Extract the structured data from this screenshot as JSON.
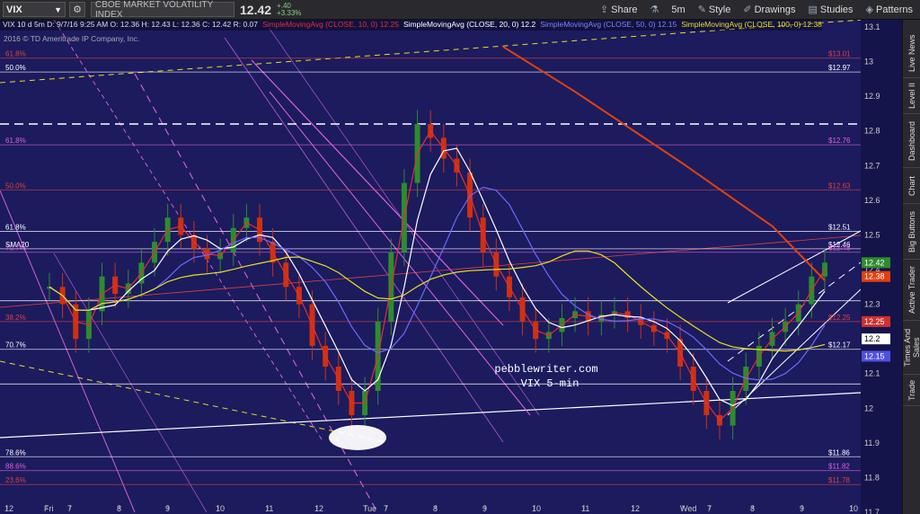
{
  "toolbar": {
    "symbol": "VIX",
    "symbol_name": "CBOE MARKET VOLATILITY INDEX",
    "last": "12.42",
    "change_top": "+.40",
    "change_bottom": "+3.33%",
    "share_label": "Share",
    "interval_label": "5m",
    "style_label": "Style",
    "drawings_label": "Drawings",
    "studies_label": "Studies",
    "patterns_label": "Patterns"
  },
  "legend": {
    "ohlc": "VIX 10 d 5m  D: 9/7/16 9:25 AM  O: 12.36  H: 12.43  L: 12.36  C: 12.42  R: 0.07",
    "sma10": "SimpleMovingAvg (CLOSE, 10, 0)  12.25",
    "sma20": "SimpleMovingAvg (CLOSE, 20, 0)  12.2",
    "sma50": "SimpleMovingAvg (CLOSE, 50, 0)  12.15",
    "sma100": "SimpleMovingAvg (CLOSE, 100, 0)  12.38"
  },
  "copyright": "2016 © TD Ameritrade IP Company, Inc.",
  "annotation": {
    "line1": "pebblewriter.com",
    "line2": "VIX 5-min"
  },
  "colors": {
    "background": "#1c1b5e",
    "candle_up": "#2e8b2e",
    "candle_down": "#d03010",
    "sma10": "#e03030",
    "sma20": "#ffffff",
    "sma50": "#6a6aff",
    "sma100": "#e8e020",
    "accent_orange": "#e04010"
  },
  "chart_data": {
    "type": "candlestick",
    "y_axis": {
      "min": 11.7,
      "max": 13.1,
      "ticks": [
        "13.1",
        "13",
        "12.9",
        "12.8",
        "12.7",
        "12.6",
        "12.5",
        "12.4",
        "12.3",
        "12.2",
        "12.1",
        "12",
        "11.9",
        "11.8",
        "11.7"
      ]
    },
    "x_axis": {
      "ticks": [
        "12",
        "Fri",
        "7",
        "8",
        "9",
        "10",
        "11",
        "12",
        "Tue",
        "7",
        "8",
        "9",
        "10",
        "11",
        "12",
        "Wed",
        "7",
        "8",
        "9",
        "10"
      ]
    },
    "price_labels": [
      {
        "text": "$13.01",
        "value": 13.01,
        "color": "#e04040"
      },
      {
        "text": "$12.97",
        "value": 12.97,
        "color": "#ffffff"
      },
      {
        "text": "$12.76",
        "value": 12.76,
        "color": "#e060e0"
      },
      {
        "text": "$12.63",
        "value": 12.63,
        "color": "#e04040"
      },
      {
        "text": "$12.51",
        "value": 12.51,
        "color": "#ffffff"
      },
      {
        "text": "$12.46",
        "value": 12.46,
        "color": "#ffffff"
      },
      {
        "text": "$12.45",
        "value": 12.45,
        "color": "#e060e0"
      },
      {
        "text": "$12.25",
        "value": 12.25,
        "color": "#e04040"
      },
      {
        "text": "$12.17",
        "value": 12.17,
        "color": "#ffffff"
      },
      {
        "text": "$11.86",
        "value": 11.86,
        "color": "#ffffff"
      },
      {
        "text": "$11.82",
        "value": 11.82,
        "color": "#e060e0"
      },
      {
        "text": "$11.78",
        "value": 11.78,
        "color": "#e04040"
      }
    ],
    "fib_labels": [
      {
        "text": "61.8%",
        "value": 13.01,
        "color": "#e04040"
      },
      {
        "text": "50.0%",
        "value": 12.97,
        "color": "#ffffff"
      },
      {
        "text": "61.8%",
        "value": 12.76,
        "color": "#e060e0"
      },
      {
        "text": "50.0%",
        "value": 12.63,
        "color": "#e04040"
      },
      {
        "text": "61.8%",
        "value": 12.51,
        "color": "#ffffff"
      },
      {
        "text": "SMA20",
        "value": 12.46,
        "color": "#ffffff"
      },
      {
        "text": "70.7%",
        "value": 12.45,
        "color": "#e060e0"
      },
      {
        "text": "38.2%",
        "value": 12.25,
        "color": "#e04040"
      },
      {
        "text": "70.7%",
        "value": 12.17,
        "color": "#ffffff"
      },
      {
        "text": "78.6%",
        "value": 11.86,
        "color": "#ffffff"
      },
      {
        "text": "88.6%",
        "value": 11.82,
        "color": "#e060e0"
      },
      {
        "text": "23.6%",
        "value": 11.78,
        "color": "#e04040"
      }
    ],
    "axis_badges": [
      {
        "text": "12.42",
        "value": 12.42,
        "bg": "#2e8b2e"
      },
      {
        "text": "12.38",
        "value": 12.38,
        "bg": "#e04010"
      },
      {
        "text": "12.25",
        "value": 12.25,
        "bg": "#d03030"
      },
      {
        "text": "12.2",
        "value": 12.2,
        "bg": "#ffffff"
      },
      {
        "text": "12.15",
        "value": 12.15,
        "bg": "#5050e0"
      }
    ],
    "close_series": [
      12.35,
      12.3,
      12.2,
      12.28,
      12.38,
      12.33,
      12.36,
      12.42,
      12.48,
      12.55,
      12.5,
      12.46,
      12.43,
      12.45,
      12.52,
      12.55,
      12.48,
      12.42,
      12.35,
      12.3,
      12.18,
      12.12,
      12.05,
      11.98,
      12.05,
      12.25,
      12.45,
      12.65,
      12.82,
      12.78,
      12.72,
      12.68,
      12.55,
      12.45,
      12.38,
      12.32,
      12.25,
      12.2,
      12.22,
      12.26,
      12.28,
      12.25,
      12.27,
      12.28,
      12.26,
      12.24,
      12.22,
      12.2,
      12.12,
      12.05,
      11.98,
      11.95,
      12.05,
      12.12,
      12.18,
      12.22,
      12.25,
      12.3,
      12.38,
      12.42
    ]
  },
  "right_nav": [
    "Live News",
    "Level II",
    "Dashboard",
    "Chart",
    "Big Buttons",
    "Active Trader",
    "Times And Sales",
    "Trade"
  ]
}
